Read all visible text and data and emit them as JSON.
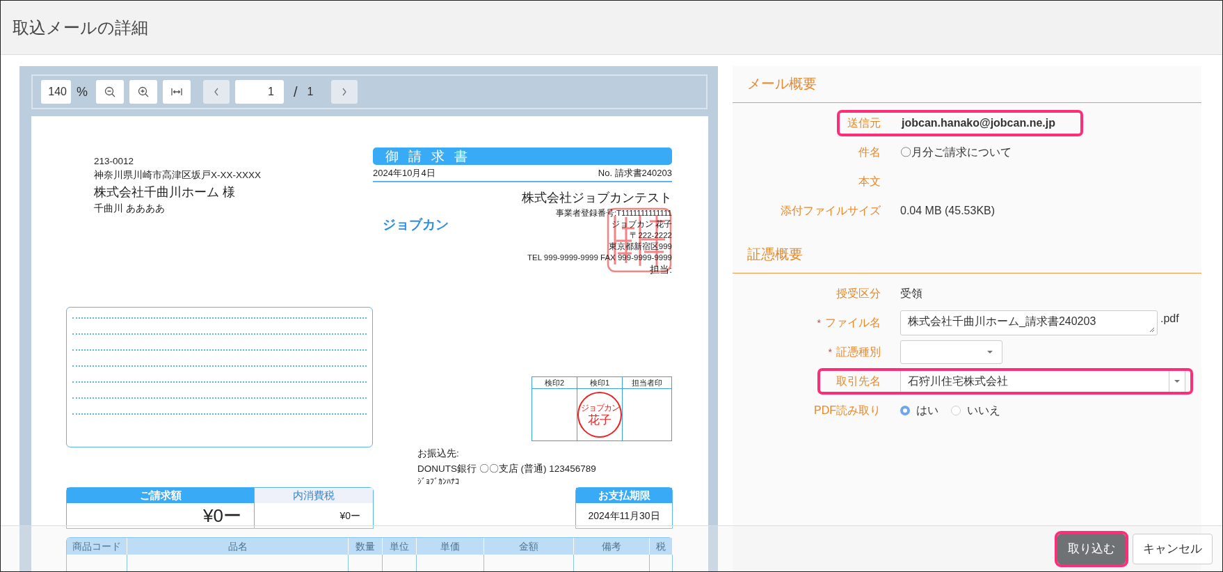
{
  "dialog": {
    "title": "取込メールの詳細"
  },
  "viewer": {
    "zoom": "140",
    "percent": "%",
    "tools": [
      {
        "kind": "zoom_out",
        "disabled": false
      },
      {
        "kind": "zoom_in",
        "disabled": false
      },
      {
        "kind": "fit_width",
        "disabled": false
      }
    ],
    "prev": {
      "disabled": true
    },
    "page": "1",
    "separator": "/",
    "total": "1",
    "next": {
      "disabled": true
    }
  },
  "invoice": {
    "recipient": {
      "postal": "213-0012",
      "address": "神奈川県川崎市高津区坂戸X-XX-XXXX",
      "company": "株式会社千曲川ホーム 様",
      "person": "千曲川 ああああ"
    },
    "title": "御請求書",
    "date": "2024年10月4日",
    "number": "No. 請求書240203",
    "issuer": {
      "company": "株式会社ジョブカンテスト",
      "registration": "事業者登録番号:T1111111111111",
      "logo": "ジョブカン",
      "lines": [
        "ジョブカン 花子",
        "〒222-2222",
        "東京都新宿区999"
      ],
      "phone": "TEL 999-9999-9999 FAX 999-9999-9999",
      "contact": "担当:"
    },
    "stamp_columns": [
      {
        "header": "検印2",
        "stamped": false
      },
      {
        "header": "検印1",
        "stamped": true,
        "seal": [
          "ジョブカン",
          "花子"
        ]
      },
      {
        "header": "担当者印",
        "stamped": false
      }
    ],
    "bank": {
      "label": "お振込先:",
      "account": "DONUTS銀行 〇〇支店 (普通) 123456789",
      "holder": "ｼﾞｮﾌﾞｶﾝﾊﾅｺ"
    },
    "amount": {
      "label": "ご請求額",
      "value": "¥0ー"
    },
    "tax": {
      "label": "内消費税",
      "value": "¥0ー"
    },
    "due": {
      "label": "お支払期限",
      "value": "2024年11月30日"
    },
    "item_columns": [
      "商品コード",
      "品名",
      "数量",
      "単位",
      "単価",
      "金額",
      "備考",
      "税"
    ]
  },
  "mail_summary": {
    "heading": "メール概要",
    "rows": [
      {
        "label": "送信元",
        "value": "jobcan.hanako@jobcan.ne.jp",
        "highlighted": true
      },
      {
        "label": "件名",
        "value": "〇月分ご請求について",
        "highlighted": false
      },
      {
        "label": "本文",
        "value": "",
        "highlighted": false
      },
      {
        "label": "添付ファイルサイズ",
        "value": "0.04 MB (45.53KB)",
        "highlighted": false
      }
    ]
  },
  "voucher_summary": {
    "heading": "証憑概要",
    "rows": [
      {
        "kind": "text",
        "label": "授受区分",
        "required": false,
        "highlighted": false,
        "value": "受領"
      },
      {
        "kind": "textarea",
        "label": "ファイル名",
        "required": true,
        "required_mark": "*",
        "highlighted": false,
        "value": "株式会社千曲川ホーム_請求書240203",
        "suffix": ".pdf"
      },
      {
        "kind": "select",
        "label": "証憑種別",
        "required": true,
        "required_mark": "*",
        "highlighted": false
      },
      {
        "kind": "combo",
        "label": "取引先名",
        "required": false,
        "highlighted": true,
        "value": "石狩川住宅株式会社"
      },
      {
        "kind": "radio",
        "label": "PDF読み取り",
        "required": false,
        "highlighted": false,
        "options": [
          {
            "label": "はい",
            "selected": true
          },
          {
            "label": "いいえ",
            "selected": false
          }
        ]
      }
    ]
  },
  "footer": {
    "buttons": [
      {
        "label": "取り込む",
        "kind": "primary",
        "highlighted": true
      },
      {
        "label": "キャンセル",
        "kind": "default",
        "highlighted": false
      }
    ]
  }
}
